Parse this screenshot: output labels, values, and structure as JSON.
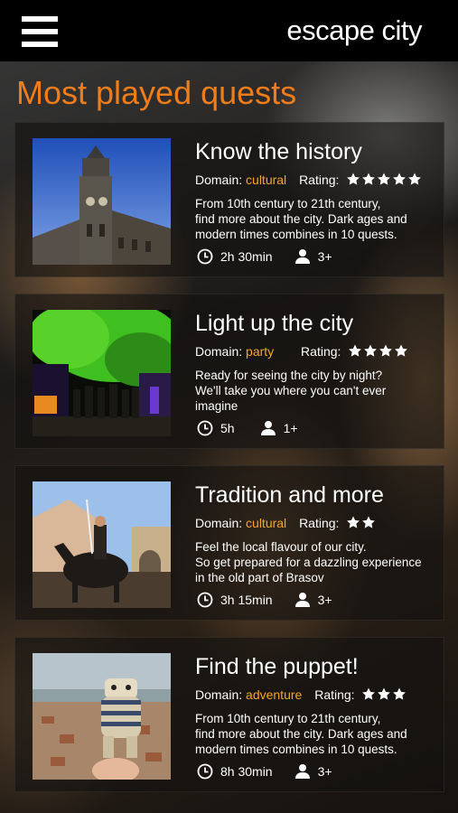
{
  "header": {
    "app_title": "escape city",
    "menu_icon": "hamburger-menu-icon"
  },
  "section_title": "Most played quests",
  "colors": {
    "accent": "#f07d1a",
    "domain": "#f5a623",
    "header_bg": "#000000"
  },
  "labels": {
    "domain": "Domain:",
    "rating": "Rating:"
  },
  "quests": [
    {
      "title": "Know the history",
      "domain": "cultural",
      "rating": 5,
      "description": [
        "From 10th century to 21th century,",
        "find more about the city. Dark ages and",
        "modern times combines in 10 quests."
      ],
      "duration": "2h 30min",
      "players": "3+",
      "image": "clock-tower-photo"
    },
    {
      "title": "Light up the city",
      "domain": "party",
      "rating": 4,
      "description": [
        "Ready for seeing the city by night?",
        "We'll take you where you can't ever",
        "imagine"
      ],
      "duration": "5h",
      "players": "1+",
      "image": "night-party-photo"
    },
    {
      "title": "Tradition and more",
      "domain": "cultural",
      "rating": 2,
      "description": [
        "Feel the local flavour of our city.",
        "So get prepared for a dazzling experience",
        "in the old part of Brasov"
      ],
      "duration": "3h 15min",
      "players": "3+",
      "image": "horse-rider-photo"
    },
    {
      "title": "Find the puppet!",
      "domain": "adventure",
      "rating": 3,
      "description": [
        "From 10th century to 21th century,",
        "find more about the city. Dark ages and",
        "modern times combines in 10 quests."
      ],
      "duration": "8h 30min",
      "players": "3+",
      "image": "puppet-over-city-photo"
    }
  ]
}
